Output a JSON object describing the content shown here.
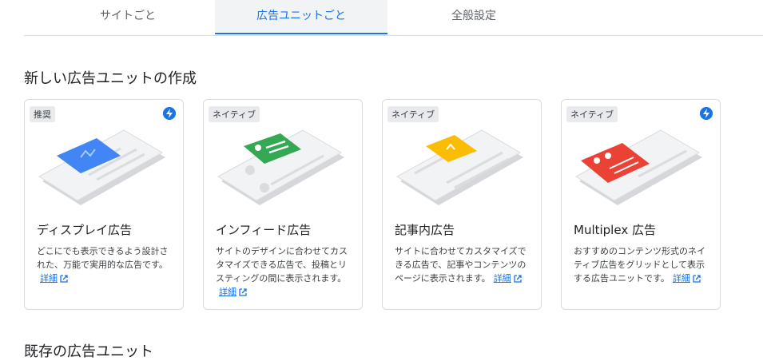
{
  "tabs": [
    {
      "label": "サイトごと",
      "active": false
    },
    {
      "label": "広告ユニットごと",
      "active": true
    },
    {
      "label": "全般設定",
      "active": false
    }
  ],
  "new_section": {
    "title": "新しい広告ユニットの作成"
  },
  "existing_section": {
    "title": "既存の広告ユニット"
  },
  "cards": [
    {
      "badge": "推奨",
      "title": "ディスプレイ広告",
      "desc": "どこにでも表示できるよう設計された、万能で実用的な広告です。",
      "link": "詳細",
      "accent": "#4285f4",
      "bolt": true
    },
    {
      "badge": "ネイティブ",
      "title": "インフィード広告",
      "desc": "サイトのデザインに合わせてカスタマイズできる広告で、投稿とリスティングの間に表示されます。",
      "link": "詳細",
      "accent": "#34a853",
      "bolt": false
    },
    {
      "badge": "ネイティブ",
      "title": "記事内広告",
      "desc": "サイトに合わせてカスタマイズできる広告で、記事やコンテンツのページに表示されます。",
      "link": "詳細",
      "accent": "#fbbc04",
      "bolt": false
    },
    {
      "badge": "ネイティブ",
      "title": "Multiplex 広告",
      "desc": "おすすめのコンテンツ形式のネイティブ広告をグリッドとして表示する広告ユニットです。",
      "link": "詳細",
      "accent": "#ea4335",
      "bolt": true
    }
  ],
  "colors": {
    "link": "#1a73e8",
    "bolt": "#1a73e8",
    "tab_active": "#1a73e8"
  }
}
